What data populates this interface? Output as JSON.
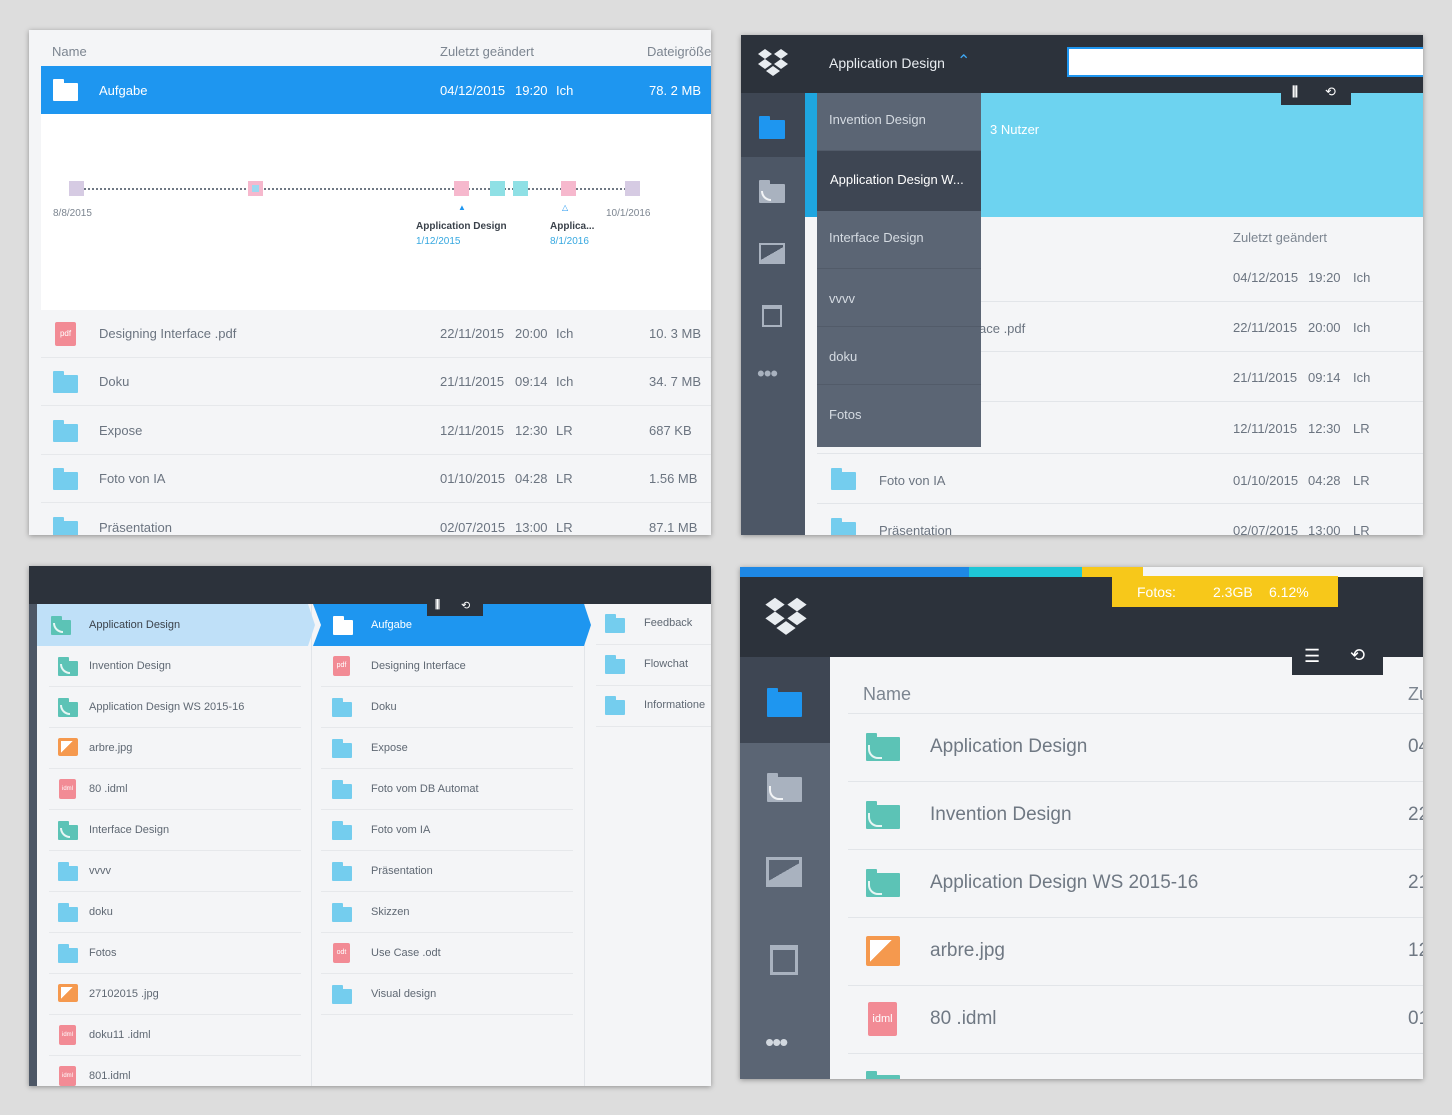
{
  "p1": {
    "headers": {
      "name": "Name",
      "modified": "Zuletzt geändert",
      "size": "Dateigröße"
    },
    "selected": {
      "name": "Aufgabe",
      "date": "04/12/2015",
      "time": "19:20",
      "user": "Ich",
      "size": "78. 2 MB"
    },
    "timeline": {
      "start": "8/8/2015",
      "end": "10/1/2016",
      "m1_title": "Application Design",
      "m1_date": "1/12/2015",
      "m2_title": "Applica...",
      "m2_date": "8/1/2016"
    },
    "rows": [
      {
        "name": "Designing Interface .pdf",
        "date": "22/11/2015",
        "time": "20:00",
        "user": "Ich",
        "size": "10. 3 MB",
        "icon": "pdf"
      },
      {
        "name": "Doku",
        "date": "21/11/2015",
        "time": "09:14",
        "user": "Ich",
        "size": "34. 7 MB",
        "icon": "folder"
      },
      {
        "name": "Expose",
        "date": "12/11/2015",
        "time": "12:30",
        "user": "LR",
        "size": "687 KB",
        "icon": "folder"
      },
      {
        "name": "Foto von IA",
        "date": "01/10/2015",
        "time": "04:28",
        "user": "LR",
        "size": "1.56 MB",
        "icon": "folder"
      },
      {
        "name": "Präsentation",
        "date": "02/07/2015",
        "time": "13:00",
        "user": "LR",
        "size": "87.1 MB",
        "icon": "folder"
      }
    ]
  },
  "p2": {
    "title": "Application Design",
    "search_placeholder": "",
    "dropdown": [
      "Invention Design",
      "Application Design W...",
      "Interface Design",
      "vvvv",
      "doku",
      "Fotos"
    ],
    "users": "3 Nutzer",
    "header_modified": "Zuletzt geändert",
    "pdf_fragment": "ace .pdf",
    "rows": [
      {
        "date": "04/12/2015",
        "time": "19:20",
        "user": "Ich"
      },
      {
        "date": "22/11/2015",
        "time": "20:00",
        "user": "Ich"
      },
      {
        "date": "21/11/2015",
        "time": "09:14",
        "user": "Ich"
      },
      {
        "date": "12/11/2015",
        "time": "12:30",
        "user": "LR"
      },
      {
        "name": "Foto von IA",
        "date": "01/10/2015",
        "time": "04:28",
        "user": "LR"
      },
      {
        "name": "Präsentation",
        "date": "02/07/2015",
        "time": "13:00",
        "user": "LR"
      }
    ]
  },
  "p3": {
    "col1": [
      {
        "label": "Application Design",
        "icon": "shared-folder"
      },
      {
        "label": "Invention Design",
        "icon": "shared-folder"
      },
      {
        "label": "Application Design WS 2015-16",
        "icon": "shared-folder"
      },
      {
        "label": "arbre.jpg",
        "icon": "image"
      },
      {
        "label": "80 .idml",
        "icon": "idml"
      },
      {
        "label": "Interface Design",
        "icon": "shared-folder"
      },
      {
        "label": "vvvv",
        "icon": "folder"
      },
      {
        "label": "doku",
        "icon": "folder"
      },
      {
        "label": "Fotos",
        "icon": "folder"
      },
      {
        "label": "27102015 .jpg",
        "icon": "image"
      },
      {
        "label": "doku11 .idml",
        "icon": "idml"
      },
      {
        "label": "801.idml",
        "icon": "idml"
      }
    ],
    "col2": [
      {
        "label": "Aufgabe",
        "icon": "folder"
      },
      {
        "label": "Designing Interface",
        "icon": "pdf"
      },
      {
        "label": "Doku",
        "icon": "folder"
      },
      {
        "label": "Expose",
        "icon": "folder"
      },
      {
        "label": "Foto vom DB Automat",
        "icon": "folder"
      },
      {
        "label": "Foto vom IA",
        "icon": "folder"
      },
      {
        "label": "Präsentation",
        "icon": "folder"
      },
      {
        "label": "Skizzen",
        "icon": "folder"
      },
      {
        "label": "Use Case .odt",
        "icon": "odt"
      },
      {
        "label": "Visual design",
        "icon": "folder"
      }
    ],
    "col3": [
      {
        "label": "Feedback"
      },
      {
        "label": "Flowchat"
      },
      {
        "label": "Informatione"
      }
    ]
  },
  "p4": {
    "storage": {
      "label": "Fotos:",
      "size": "2.3GB",
      "percent": "6.12%"
    },
    "usage_segments": [
      {
        "color": "#1e88e5",
        "fraction": 0.335
      },
      {
        "color": "#1ec6d6",
        "fraction": 0.165
      },
      {
        "color": "#f7c81a",
        "fraction": 0.09
      }
    ],
    "header_name": "Name",
    "header_modified_fragment": "Zu",
    "rows": [
      {
        "name": "Application Design",
        "date_fragment": "04",
        "icon": "shared-folder"
      },
      {
        "name": "Invention Design",
        "date_fragment": "22",
        "icon": "shared-folder"
      },
      {
        "name": "Application Design WS 2015-16",
        "date_fragment": "21",
        "icon": "shared-folder"
      },
      {
        "name": "arbre.jpg",
        "date_fragment": "12",
        "icon": "image"
      },
      {
        "name": "80 .idml",
        "date_fragment": "01",
        "icon": "idml"
      }
    ]
  },
  "colors": {
    "accent": "#1e96f0",
    "sidebar": "#4d5766",
    "topbar": "#2c323b",
    "cyan": "#6dd3f0",
    "yellow": "#f7c81a"
  }
}
